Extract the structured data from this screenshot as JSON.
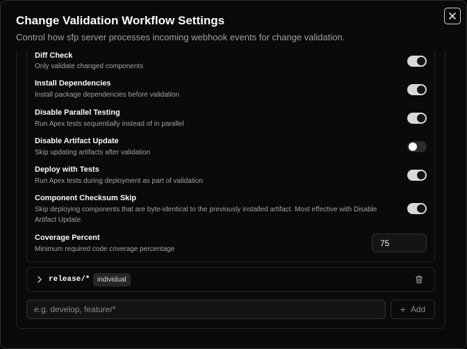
{
  "dialog": {
    "title": "Change Validation Workflow Settings",
    "subtitle": "Control how sfp server processes incoming webhook events for change validation."
  },
  "settings": [
    {
      "label": "Diff Check",
      "description": "Only validate changed components",
      "enabled": true
    },
    {
      "label": "Install Dependencies",
      "description": "Install package dependencies before validation",
      "enabled": true
    },
    {
      "label": "Disable Parallel Testing",
      "description": "Run Apex tests sequentially instead of in parallel",
      "enabled": true
    },
    {
      "label": "Disable Artifact Update",
      "description": "Skip updating artifacts after validation",
      "enabled": false
    },
    {
      "label": "Deploy with Tests",
      "description": "Run Apex tests during deployment as part of validation",
      "enabled": true
    },
    {
      "label": "Component Checksum Skip",
      "description": "Skip deploying components that are byte-identical to the previously installed artifact. Most effective with Disable Artifact Update.",
      "enabled": true
    }
  ],
  "coverage": {
    "label": "Coverage Percent",
    "description": "Minimum required code coverage percentage",
    "value": "75"
  },
  "branch_rule": {
    "pattern": "release/*",
    "mode": "individual"
  },
  "add_pattern": {
    "placeholder": "e.g. develop, feature/*",
    "button_label": "Add"
  },
  "icons": {
    "close": "close-icon",
    "chevron": "chevron-right-icon",
    "trash": "trash-icon",
    "plus": "plus-icon"
  }
}
